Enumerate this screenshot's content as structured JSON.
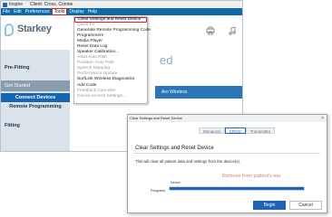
{
  "window": {
    "app_name": "Inspire",
    "client_label": "Client: Cross, Connie"
  },
  "menubar": {
    "items": [
      "File",
      "Edit",
      "Preferences",
      "Tools",
      "Display",
      "Help"
    ],
    "active": "Tools"
  },
  "brand": {
    "name": "Starkey"
  },
  "banner": {
    "partial_text": "ed"
  },
  "sidebar": {
    "pre_fitting": "Pre-Fitting",
    "get_started": "Get Started",
    "connect_devices": "Connect Devices",
    "remote_programming": "Remote Programming",
    "fitting": "Fitting"
  },
  "content": {
    "wireless_partial": "Aro Wireless"
  },
  "tools_menu": {
    "items": [
      {
        "label": "Clear Settings and Reset Device",
        "state": "highlighted"
      },
      {
        "label": "Quick Fit",
        "state": "disabled"
      },
      {
        "label": "Generate Remote Programming Code",
        "state": "enabled"
      },
      {
        "label": "Programmers",
        "state": "enabled"
      },
      {
        "label": "Media Player",
        "state": "enabled"
      },
      {
        "label": "Reset Data Log",
        "state": "enabled"
      },
      {
        "label": "Speaker Calibration...",
        "state": "enabled"
      },
      {
        "label": "Adult Auto Path",
        "state": "disabled"
      },
      {
        "label": "Pediatric Auto Path",
        "state": "disabled"
      },
      {
        "label": "Speech Mapping",
        "state": "disabled"
      },
      {
        "label": "Performance Update",
        "state": "disabled"
      },
      {
        "label": "SurfLink Wireless Diagnostics",
        "state": "enabled"
      },
      {
        "label": "Add Code",
        "state": "enabled"
      },
      {
        "label": "Feedback Canceller",
        "state": "disabled"
      },
      {
        "label": "Device Access Settings...",
        "state": "disabled"
      }
    ]
  },
  "dialog": {
    "title": "Clear Settings and Reset Device",
    "tabs": [
      "Monaural",
      "CROS",
      "Transmitter"
    ],
    "active_tab": "CROS",
    "heading": "Clear Settings and Reset Device",
    "message": "This will clear all patient data and settings from the device(s).",
    "status": "Remove from patient's ear.",
    "device_label": "Device",
    "progress_label": "Progress",
    "progress": 1.0,
    "begin_label": "Begin",
    "cancel_label": "Cancel",
    "close_glyph": "×"
  },
  "colors": {
    "menubar": "#0e6aa8",
    "highlight_border": "#d2232a",
    "primary": "#1e63b5",
    "sidebar": "#dbe3ea",
    "status_text": "#e07878"
  }
}
